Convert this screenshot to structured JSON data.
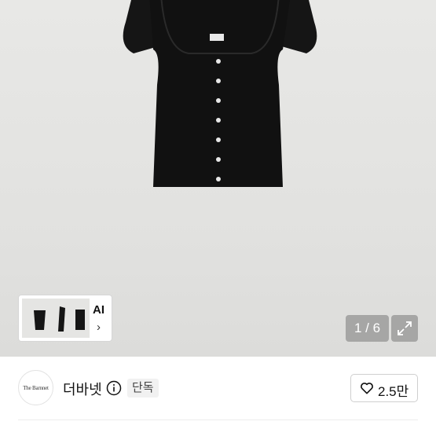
{
  "gallery": {
    "counter": "1 / 6",
    "thumbnail_strip": {
      "ai_label": "AI",
      "chevron": "›"
    }
  },
  "shop": {
    "logo_text": "The Barnnet",
    "name": "더바넷",
    "badge": "단독",
    "like_count": "2.5만"
  },
  "icons": {
    "info": "info-icon",
    "heart": "heart-outline-icon",
    "expand": "expand-icon",
    "chevron": "chevron-right-icon"
  }
}
